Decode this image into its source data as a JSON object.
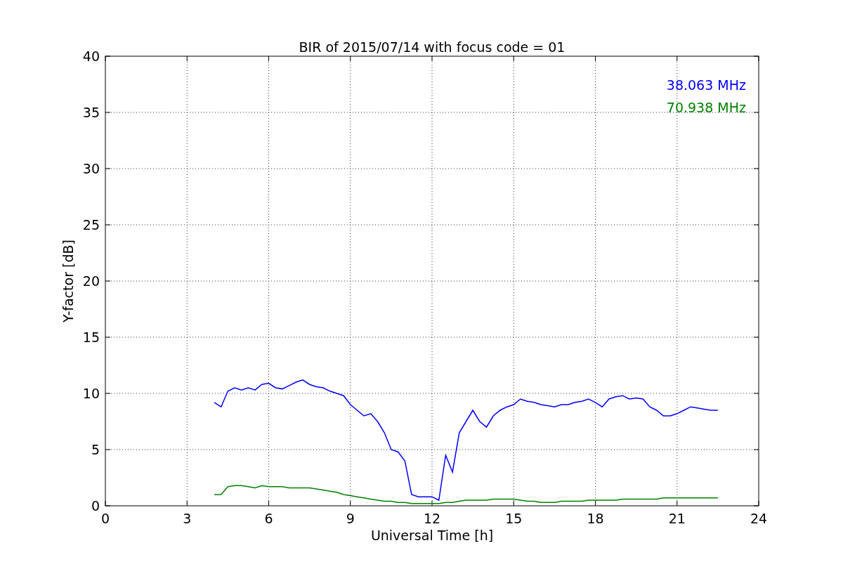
{
  "figure": {
    "chart_data": {
      "type": "line",
      "title": "BIR of 2015/07/14 with focus code = 01",
      "xlabel": "Universal Time [h]",
      "ylabel": "Y-factor [dB]",
      "x": [
        4.0,
        4.25,
        4.5,
        4.75,
        5.0,
        5.25,
        5.5,
        5.75,
        6.0,
        6.25,
        6.5,
        6.75,
        7.0,
        7.25,
        7.5,
        7.75,
        8.0,
        8.25,
        8.5,
        8.75,
        9.0,
        9.25,
        9.5,
        9.75,
        10.0,
        10.25,
        10.5,
        10.75,
        11.0,
        11.25,
        11.5,
        11.75,
        12.0,
        12.25,
        12.5,
        12.75,
        13.0,
        13.25,
        13.5,
        13.75,
        14.0,
        14.25,
        14.5,
        14.75,
        15.0,
        15.25,
        15.5,
        15.75,
        16.0,
        16.25,
        16.5,
        16.75,
        17.0,
        17.25,
        17.5,
        17.75,
        18.0,
        18.25,
        18.5,
        18.75,
        19.0,
        19.25,
        19.5,
        19.75,
        20.0,
        20.25,
        20.5,
        20.75,
        21.0,
        21.25,
        21.5,
        21.75,
        22.0,
        22.25,
        22.5
      ],
      "series": [
        {
          "name": "38.063 MHz",
          "color": "#0000ff",
          "values": [
            9.2,
            8.8,
            10.2,
            10.5,
            10.3,
            10.5,
            10.3,
            10.8,
            10.9,
            10.5,
            10.4,
            10.7,
            11.0,
            11.2,
            10.8,
            10.6,
            10.5,
            10.2,
            10.0,
            9.8,
            9.0,
            8.5,
            8.0,
            8.2,
            7.5,
            6.5,
            5.0,
            4.8,
            4.0,
            1.0,
            0.8,
            0.8,
            0.8,
            0.5,
            4.5,
            3.0,
            6.5,
            7.5,
            8.5,
            7.5,
            7.0,
            8.0,
            8.5,
            8.8,
            9.0,
            9.5,
            9.3,
            9.2,
            9.0,
            8.9,
            8.8,
            9.0,
            9.0,
            9.2,
            9.3,
            9.5,
            9.2,
            8.8,
            9.5,
            9.7,
            9.8,
            9.5,
            9.6,
            9.5,
            8.8,
            8.5,
            8.0,
            8.0,
            8.2,
            8.5,
            8.8,
            8.7,
            8.6,
            8.5,
            8.5
          ]
        },
        {
          "name": "70.938 MHz",
          "color": "#008000",
          "values": [
            1.0,
            1.0,
            1.7,
            1.8,
            1.8,
            1.7,
            1.6,
            1.8,
            1.7,
            1.7,
            1.7,
            1.6,
            1.6,
            1.6,
            1.6,
            1.5,
            1.4,
            1.3,
            1.2,
            1.0,
            0.9,
            0.8,
            0.7,
            0.6,
            0.5,
            0.4,
            0.4,
            0.3,
            0.3,
            0.2,
            0.2,
            0.2,
            0.2,
            0.2,
            0.3,
            0.3,
            0.4,
            0.5,
            0.5,
            0.5,
            0.5,
            0.6,
            0.6,
            0.6,
            0.6,
            0.5,
            0.4,
            0.4,
            0.3,
            0.3,
            0.3,
            0.4,
            0.4,
            0.4,
            0.4,
            0.5,
            0.5,
            0.5,
            0.5,
            0.5,
            0.6,
            0.6,
            0.6,
            0.6,
            0.6,
            0.6,
            0.7,
            0.7,
            0.7,
            0.7,
            0.7,
            0.7,
            0.7,
            0.7,
            0.7
          ]
        }
      ],
      "grid": true,
      "xlim": [
        0,
        24
      ],
      "ylim": [
        0,
        40
      ],
      "xticks": [
        0,
        3,
        6,
        9,
        12,
        15,
        18,
        21,
        24
      ],
      "yticks": [
        0,
        5,
        10,
        15,
        20,
        25,
        30,
        35,
        40
      ]
    }
  }
}
